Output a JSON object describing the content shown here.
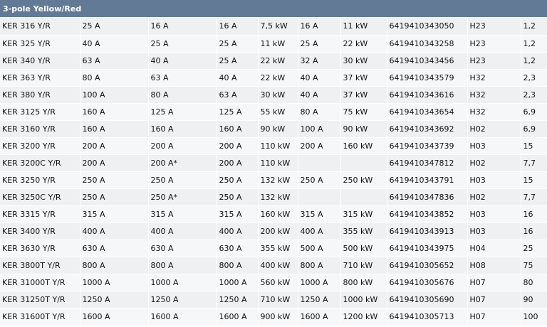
{
  "title": "3-pole Yellow/Red",
  "rows": [
    [
      "KER 316 Y/R",
      "25 A",
      "16 A",
      "16 A",
      "7,5 kW",
      "16 A",
      "11 kW",
      "6419410343050",
      "H23",
      "1,2"
    ],
    [
      "KER 325 Y/R",
      "40 A",
      "25 A",
      "25 A",
      "11 kW",
      "25 A",
      "22 kW",
      "6419410343258",
      "H23",
      "1,2"
    ],
    [
      "KER 340 Y/R",
      "63 A",
      "40 A",
      "25 A",
      "22 kW",
      "32 A",
      "30 kW",
      "6419410343456",
      "H23",
      "1,2"
    ],
    [
      "KER 363 Y/R",
      "80 A",
      "63 A",
      "40 A",
      "22 kW",
      "40 A",
      "37 kW",
      "6419410343579",
      "H32",
      "2,3"
    ],
    [
      "KER 380 Y/R",
      "100 A",
      "80 A",
      "63 A",
      "30 kW",
      "40 A",
      "37 kW",
      "6419410343616",
      "H32",
      "2,3"
    ],
    [
      "KER 3125 Y/R",
      "160 A",
      "125 A",
      "125 A",
      "55 kW",
      "80 A",
      "75 kW",
      "6419410343654",
      "H32",
      "6,9"
    ],
    [
      "KER 3160 Y/R",
      "160 A",
      "160 A",
      "160 A",
      "90 kW",
      "100 A",
      "90 kW",
      "6419410343692",
      "H02",
      "6,9"
    ],
    [
      "KER 3200 Y/R",
      "200 A",
      "200 A",
      "200 A",
      "110 kW",
      "200 A",
      "160 kW",
      "6419410343739",
      "H03",
      "15"
    ],
    [
      "KER 3200C Y/R",
      "200 A",
      "200 A*",
      "200 A",
      "110 kW",
      "",
      "",
      "6419410347812",
      "H02",
      "7,7"
    ],
    [
      "KER 3250 Y/R",
      "250 A",
      "250 A",
      "250 A",
      "132 kW",
      "250 A",
      "250 kW",
      "6419410343791",
      "H03",
      "15"
    ],
    [
      "KER 3250C Y/R",
      "250 A",
      "250 A*",
      "250 A",
      "132 kW",
      "",
      "",
      "6419410347836",
      "H02",
      "7,7"
    ],
    [
      "KER 3315 Y/R",
      "315 A",
      "315 A",
      "315 A",
      "160 kW",
      "315 A",
      "315 kW",
      "6419410343852",
      "H03",
      "16"
    ],
    [
      "KER 3400 Y/R",
      "400 A",
      "400 A",
      "400 A",
      "200 kW",
      "400 A",
      "355 kW",
      "6419410343913",
      "H03",
      "16"
    ],
    [
      "KER 3630 Y/R",
      "630 A",
      "630 A",
      "630 A",
      "355 kW",
      "500 A",
      "500 kW",
      "6419410343975",
      "H04",
      "25"
    ],
    [
      "KER 3800T Y/R",
      "800 A",
      "800 A",
      "800 A",
      "400 kW",
      "800 A",
      "710 kW",
      "6419410305652",
      "H08",
      "75"
    ],
    [
      "KER 31000T Y/R",
      "1000 A",
      "1000 A",
      "1000 A",
      "560 kW",
      "1000 A",
      "800 kW",
      "6419410305676",
      "H07",
      "80"
    ],
    [
      "KER 31250T Y/R",
      "1250 A",
      "1250 A",
      "1250 A",
      "710 kW",
      "1250 A",
      "1000 kW",
      "6419410305690",
      "H07",
      "90"
    ],
    [
      "KER 31600T Y/R",
      "1600 A",
      "1600 A",
      "1600 A",
      "900 kW",
      "1600 A",
      "1200 kW",
      "6419410305713",
      "H07",
      "100"
    ]
  ],
  "colors": {
    "header_bg": "#627a95",
    "row_odd": "#eef0f2",
    "row_even": "#f6f7f8"
  }
}
